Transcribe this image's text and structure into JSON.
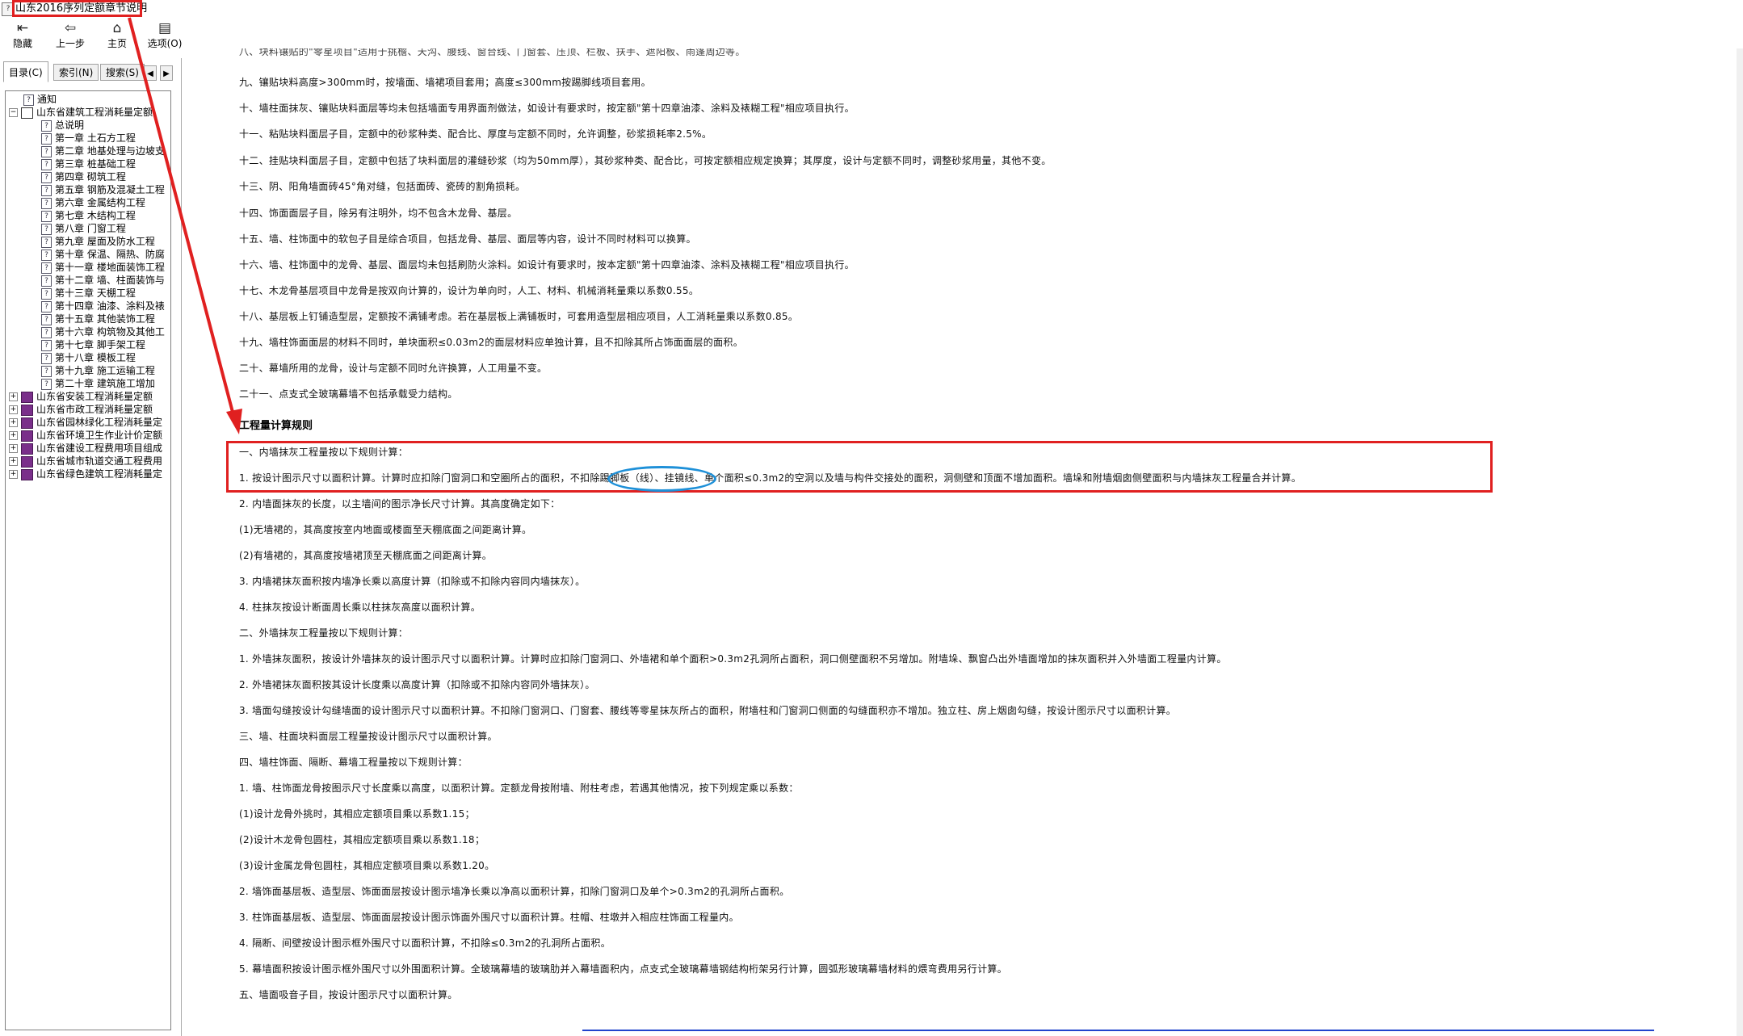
{
  "window": {
    "title": "山东2016序列定额章节说明"
  },
  "toolbar": {
    "hide": "隐藏",
    "back": "上一步",
    "home": "主页",
    "options": "选项(O)"
  },
  "tabs": {
    "contents": "目录(C)",
    "index": "索引(N)",
    "search": "搜索(S)"
  },
  "tree": {
    "notice": "通知",
    "root_building": "山东省建筑工程消耗量定额",
    "general": "总说明",
    "ch01": "第一章 土石方工程",
    "ch02": "第二章 地基处理与边坡支",
    "ch03": "第三章 桩基础工程",
    "ch04": "第四章 砌筑工程",
    "ch05": "第五章 钢筋及混凝土工程",
    "ch06": "第六章 金属结构工程",
    "ch07": "第七章 木结构工程",
    "ch08": "第八章 门窗工程",
    "ch09": "第九章 屋面及防水工程",
    "ch10": "第十章 保温、隔热、防腐",
    "ch11": "第十一章 楼地面装饰工程",
    "ch12": "第十二章 墙、柱面装饰与",
    "ch13": "第十三章 天棚工程",
    "ch14": "第十四章 油漆、涂料及裱",
    "ch15": "第十五章 其他装饰工程",
    "ch16": "第十六章 构筑物及其他工",
    "ch17": "第十七章 脚手架工程",
    "ch18": "第十八章 模板工程",
    "ch19": "第十九章 施工运输工程",
    "ch20": "第二十章 建筑施工增加",
    "install": "山东省安装工程消耗量定额",
    "municipal": "山东省市政工程消耗量定额",
    "garden": "山东省园林绿化工程消耗量定",
    "sanitation": "山东省环境卫生作业计价定额",
    "cost_items": "山东省建设工程费用项目组成",
    "rail": "山东省城市轨道交通工程费用",
    "green": "山东省绿色建筑工程消耗量定"
  },
  "content": {
    "p_top": "八、块料镶贴的\"零星项目\"适用于挑檐、天沟、腰线、窗台线、门窗套、压顶、栏板、扶手、遮阳板、雨篷周边等。",
    "p9": "九、镶贴块料高度>300mm时，按墙面、墙裙项目套用；高度≤300mm按踢脚线项目套用。",
    "p10": "十、墙柱面抹灰、镶贴块料面层等均未包括墙面专用界面剂做法，如设计有要求时，按定额\"第十四章油漆、涂料及裱糊工程\"相应项目执行。",
    "p11": "十一、粘贴块料面层子目，定额中的砂浆种类、配合比、厚度与定额不同时，允许调整，砂浆损耗率2.5%。",
    "p12": "十二、挂贴块料面层子目，定额中包括了块料面层的灌缝砂浆（均为50mm厚），其砂浆种类、配合比，可按定额相应规定换算；其厚度，设计与定额不同时，调整砂浆用量，其他不变。",
    "p13": "十三、阴、阳角墙面砖45°角对缝，包括面砖、瓷砖的割角损耗。",
    "p14": "十四、饰面面层子目，除另有注明外，均不包含木龙骨、基层。",
    "p15": "十五、墙、柱饰面中的软包子目是综合项目，包括龙骨、基层、面层等内容，设计不同时材料可以换算。",
    "p16": "十六、墙、柱饰面中的龙骨、基层、面层均未包括刷防火涂料。如设计有要求时，按本定额\"第十四章油漆、涂料及裱糊工程\"相应项目执行。",
    "p17": "十七、木龙骨基层项目中龙骨是按双向计算的，设计为单向时，人工、材料、机械消耗量乘以系数0.55。",
    "p18": "十八、基层板上钉铺造型层，定额按不满铺考虑。若在基层板上满铺板时，可套用造型层相应项目，人工消耗量乘以系数0.85。",
    "p19": "十九、墙柱饰面面层的材料不同时，单块面积≤0.03m2的面层材料应单独计算，且不扣除其所占饰面面层的面积。",
    "p20": "二十、幕墙所用的龙骨，设计与定额不同时允许换算，人工用量不变。",
    "p21": "二十一、点支式全玻璃幕墙不包括承载受力结构。",
    "h_rules": "工程量计算规则",
    "r1": "一、内墙抹灰工程量按以下规则计算：",
    "r1_1": "1. 按设计图示尺寸以面积计算。计算时应扣除门窗洞口和空圈所占的面积，不扣除踢脚板（线）、挂镜线、单个面积≤0.3m2的空洞以及墙与构件交接处的面积，洞侧壁和顶面不增加面积。墙垛和附墙烟囱侧壁面积与内墙抹灰工程量合并计算。",
    "r1_2": "2. 内墙面抹灰的长度，以主墙间的图示净长尺寸计算。其高度确定如下：",
    "r1_2a": "(1)无墙裙的，其高度按室内地面或楼面至天棚底面之间距离计算。",
    "r1_2b": "(2)有墙裙的，其高度按墙裙顶至天棚底面之间距离计算。",
    "r1_3": "3. 内墙裙抹灰面积按内墙净长乘以高度计算（扣除或不扣除内容同内墙抹灰）。",
    "r1_4": "4. 柱抹灰按设计断面周长乘以柱抹灰高度以面积计算。",
    "r2": "二、外墙抹灰工程量按以下规则计算：",
    "r2_1": "1. 外墙抹灰面积，按设计外墙抹灰的设计图示尺寸以面积计算。计算时应扣除门窗洞口、外墙裙和单个面积>0.3m2孔洞所占面积，洞口侧壁面积不另增加。附墙垛、飘窗凸出外墙面增加的抹灰面积并入外墙面工程量内计算。",
    "r2_2": "2. 外墙裙抹灰面积按其设计长度乘以高度计算（扣除或不扣除内容同外墙抹灰）。",
    "r2_3": "3. 墙面勾缝按设计勾缝墙面的设计图示尺寸以面积计算。不扣除门窗洞口、门窗套、腰线等零星抹灰所占的面积，附墙柱和门窗洞口侧面的勾缝面积亦不增加。独立柱、房上烟囱勾缝，按设计图示尺寸以面积计算。",
    "r3": "三、墙、柱面块料面层工程量按设计图示尺寸以面积计算。",
    "r4": "四、墙柱饰面、隔断、幕墙工程量按以下规则计算：",
    "r4_1": "1. 墙、柱饰面龙骨按图示尺寸长度乘以高度，以面积计算。定额龙骨按附墙、附柱考虑，若遇其他情况，按下列规定乘以系数：",
    "r4_1a": "(1)设计龙骨外挑时，其相应定额项目乘以系数1.15；",
    "r4_1b": "(2)设计木龙骨包圆柱，其相应定额项目乘以系数1.18；",
    "r4_1c": "(3)设计金属龙骨包圆柱，其相应定额项目乘以系数1.20。",
    "r4_2": "2. 墙饰面基层板、造型层、饰面面层按设计图示墙净长乘以净高以面积计算，扣除门窗洞口及单个>0.3m2的孔洞所占面积。",
    "r4_3": "3. 柱饰面基层板、造型层、饰面面层按设计图示饰面外围尺寸以面积计算。柱帽、柱墩并入相应柱饰面工程量内。",
    "r4_4": "4. 隔断、间壁按设计图示框外围尺寸以面积计算，不扣除≤0.3m2的孔洞所占面积。",
    "r4_5": "5. 幕墙面积按设计图示框外围尺寸以外围面积计算。全玻璃幕墙的玻璃肋并入幕墙面积内，点支式全玻璃幕墙钢结构桁架另行计算，圆弧形玻璃幕墙材料的煨弯费用另行计算。",
    "r5": "五、墙面吸音子目，按设计图示尺寸以面积计算。"
  },
  "annotations": {
    "box_color": "#e02020",
    "oval_color": "#1e90d8"
  }
}
